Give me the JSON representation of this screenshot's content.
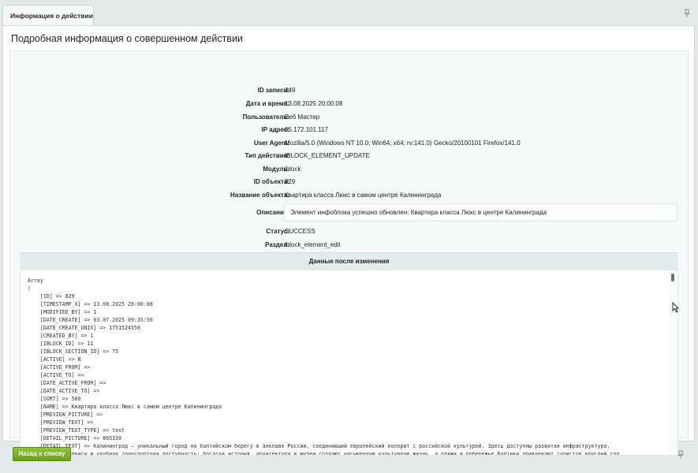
{
  "tab": {
    "label": "Информация о действии"
  },
  "page": {
    "title": "Подробная информация о совершенном действии"
  },
  "fields": [
    {
      "label": "ID записи:",
      "value": "349"
    },
    {
      "label": "Дата и время:",
      "value": "13.08.2025 20:00:08"
    },
    {
      "label": "Пользователь:",
      "value": "Веб Мастер"
    },
    {
      "label": "IP адрес:",
      "value": "85.172.101.117"
    },
    {
      "label": "User Agent:",
      "value": "Mozilla/5.0 (Windows NT 10.0; Win64; x64; rv:141.0) Gecko/20100101 Firefox/141.0"
    },
    {
      "label": "Тип действия:",
      "value": "IBLOCK_ELEMENT_UPDATE"
    },
    {
      "label": "Модуль:",
      "value": "iblock"
    },
    {
      "label": "ID объекта:",
      "value": "829"
    },
    {
      "label": "Название объекта:",
      "value": "Квартира класса Люкс в самом центре Калининграда"
    }
  ],
  "description": {
    "label": "Описание:",
    "value": "Элемент инфоблока успешно обновлен: Квартира класса Люкс в центре Калининграда"
  },
  "status": {
    "label": "Статус:",
    "value": "SUCCESS"
  },
  "section": {
    "label": "Раздел:",
    "value": "iblock_element_edit"
  },
  "after": {
    "header": "Данные после изменения",
    "lines": [
      "Array",
      "(",
      "    [ID] => 829",
      "    [TIMESTAMP_X] => 13.08.2025 20:00:08",
      "    [MODIFIED_BY] => 1",
      "    [DATE_CREATE] => 03.07.2025 09:35:56",
      "    [DATE_CREATE_UNIX] => 1751524556",
      "    [CREATED_BY] => 1",
      "    [IBLOCK_ID] => 11",
      "    [IBLOCK_SECTION_ID] => 75",
      "    [ACTIVE] => N",
      "    [ACTIVE_FROM] =>",
      "    [ACTIVE_TO] =>",
      "    [DATE_ACTIVE_FROM] =>",
      "    [DATE_ACTIVE_TO] =>",
      "    [SORT] => 500",
      "    [NAME] => Квартира класса Люкс в самом центре Калининграда",
      "    [PREVIEW_PICTURE] =>",
      "    [PREVIEW_TEXT] =>",
      "    [PREVIEW_TEXT_TYPE] => text",
      "    [DETAIL_PICTURE] => 805330",
      "    [DETAIL_TEXT] => Калининград — уникальный город на балтийском берегу в анклаве России, соединивший европейский колорит с российской культурой. Здесь доступны развитая инфраструктура,",
      "современные сервисы и удобная транспортная доступность; богатая история, архитектура и музеи создают насыщенную культурную жизнь, а пляжи и побережье Балтики привлекают туристов круглый год."
    ]
  },
  "buttons": {
    "back": "Назад к списку"
  },
  "icons": {
    "pin": "pin-icon",
    "cursor": "cursor-icon"
  }
}
